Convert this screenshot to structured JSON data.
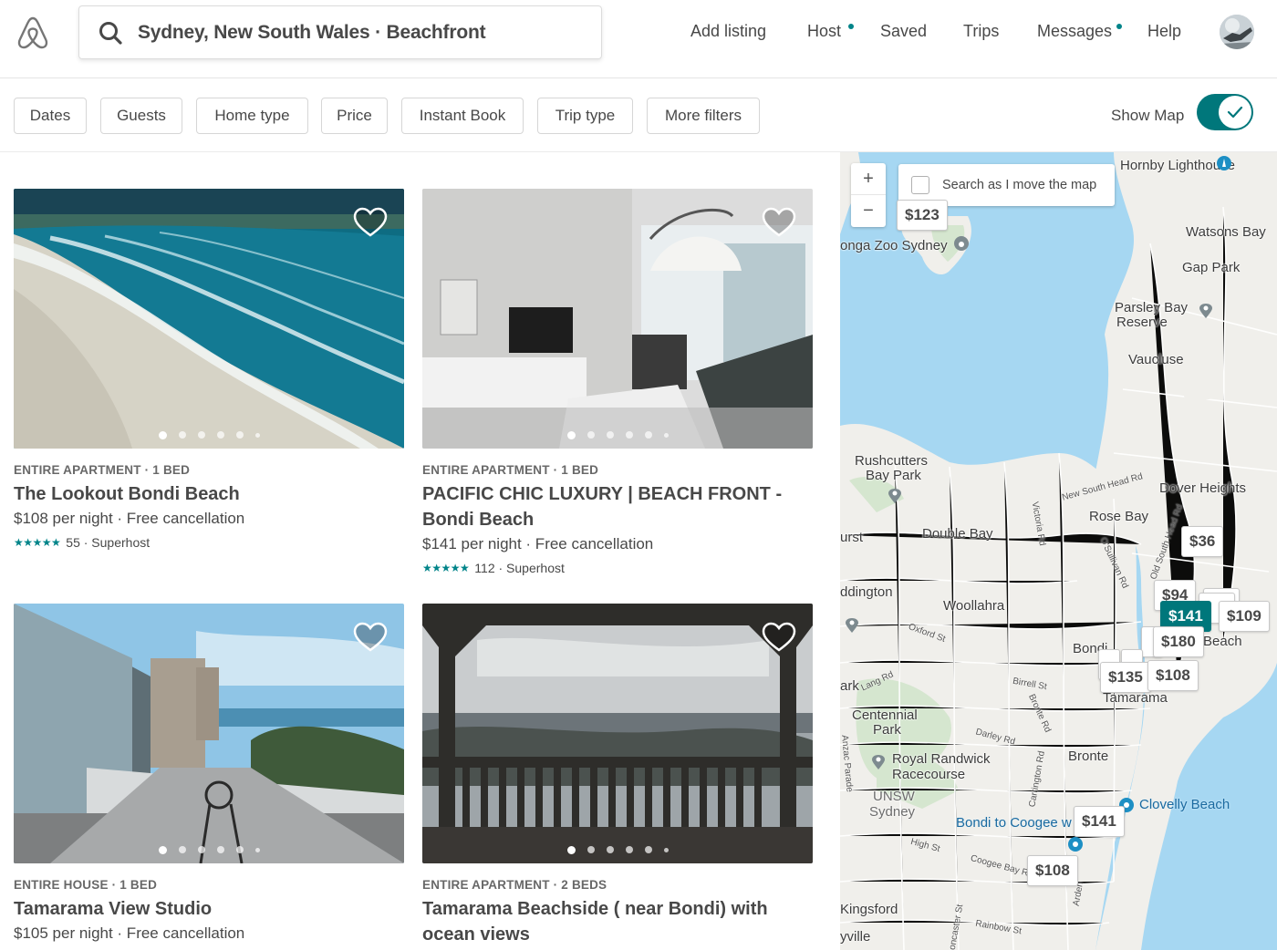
{
  "header": {
    "search_query": "Sydney, New South Wales · Beachfront",
    "nav": [
      {
        "label": "Add listing",
        "dot": false
      },
      {
        "label": "Host",
        "dot": true
      },
      {
        "label": "Saved",
        "dot": false
      },
      {
        "label": "Trips",
        "dot": false
      },
      {
        "label": "Messages",
        "dot": true
      },
      {
        "label": "Help",
        "dot": false
      }
    ],
    "accent_color": "#008489"
  },
  "filters": {
    "chips": [
      "Dates",
      "Guests",
      "Home type",
      "Price",
      "Instant Book",
      "Trip type",
      "More filters"
    ],
    "show_map_label": "Show Map",
    "show_map_on": true
  },
  "listings": [
    {
      "type": "ENTIRE APARTMENT · 1 BED",
      "title": "The Lookout Bondi Beach",
      "price": "$108 per night · Free cancellation",
      "stars": "★★★★★",
      "rating_text": "55 · Superhost",
      "photo_index": 0,
      "photo_count": 6
    },
    {
      "type": "ENTIRE APARTMENT · 1 BED",
      "title": "PACIFIC CHIC LUXURY | BEACH FRONT - Bondi Beach",
      "price": "$141 per night · Free cancellation",
      "stars": "★★★★★",
      "rating_text": "112 · Superhost",
      "photo_index": 0,
      "photo_count": 6
    },
    {
      "type": "ENTIRE HOUSE · 1 BED",
      "title": "Tamarama View Studio",
      "price": "$105 per night · Free cancellation",
      "stars": "",
      "rating_text": "",
      "photo_index": 0,
      "photo_count": 6
    },
    {
      "type": "ENTIRE APARTMENT · 2 BEDS",
      "title": "Tamarama Beachside ( near Bondi) with ocean views",
      "price": "",
      "stars": "",
      "rating_text": "",
      "photo_index": 0,
      "photo_count": 6
    }
  ],
  "map": {
    "zoom_in": "+",
    "zoom_out": "−",
    "search_as_move_label": "Search as I move the map",
    "search_as_move_checked": false,
    "price_pins": [
      {
        "label": "$123",
        "selected": false
      },
      {
        "label": "$36",
        "selected": false
      },
      {
        "label": "$94",
        "selected": false
      },
      {
        "label": "$141",
        "selected": true
      },
      {
        "label": "$109",
        "selected": false
      },
      {
        "label": "$180",
        "selected": false
      },
      {
        "label": "$135",
        "selected": false
      },
      {
        "label": "$108",
        "selected": false
      },
      {
        "label": "$141",
        "selected": false
      },
      {
        "label": "$108",
        "selected": false
      }
    ],
    "places": {
      "hornby": "Hornby Lighthouse",
      "zoo": "onga Zoo Sydney",
      "watsons": "Watsons Bay",
      "gap": "Gap Park",
      "parsley": "Parsley Bay",
      "reserve": "Reserve",
      "vaucluse": "Vaucluse",
      "rushcutters": "Rushcutters",
      "baypark": "Bay Park",
      "dover": "Dover Heights",
      "rosebay": "Rose Bay",
      "doublebay": "Double Bay",
      "urst": "urst",
      "ddington": "ddington",
      "woollahra": "Woollahra",
      "bondi": "Bondi",
      "beach": "Beach",
      "tamarama": "Tamarama",
      "ark": "ark",
      "centennial": "Centennial",
      "park": "Park",
      "randwick": "Royal Randwick",
      "racecourse": "Racecourse",
      "bronte": "Bronte",
      "unsw": "UNSW",
      "sydney": "Sydney",
      "clovelly": "Clovelly Beach",
      "walk": "Bondi to Coogee w",
      "kingsford": "Kingsford",
      "yville": "yville"
    },
    "streets": {
      "nsh": "New South Head Rd",
      "osh": "Old South Head Rd",
      "victoria": "Victoria Rd",
      "osullivan": "O'Sullivan Rd",
      "oxford": "Oxford St",
      "lang": "Lang Rd",
      "birrell": "Birrell St",
      "bronterd": "Bronte Rd",
      "darley": "Darley Rd",
      "carrington": "Carrington Rd",
      "high": "High St",
      "coogee": "Coogee Bay Rd",
      "rainbow": "Rainbow St",
      "anzac": "Anzac Parade",
      "arden": "Arden",
      "doncaster": "Doncaster St"
    }
  }
}
